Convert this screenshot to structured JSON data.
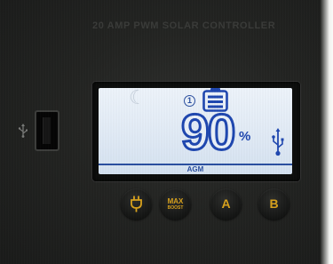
{
  "device": {
    "title": "20 AMP PWM  SOLAR CONTROLLER"
  },
  "display": {
    "mode_indicator": "1",
    "percentage_value": "90",
    "percent_unit": "%",
    "battery_type": "AGM",
    "battery_level_fraction": 1.0,
    "icons": [
      "moon-icon",
      "battery-icon",
      "usb-icon"
    ]
  },
  "buttons": {
    "power_icon": "plug-icon",
    "max_label": "MAX",
    "max_sublabel": "BOOST",
    "a_label": "A",
    "b_label": "B"
  },
  "colors": {
    "lcd_background": "#e3edf7",
    "lcd_segments": "#1f47b0",
    "button_text": "#d9a21c",
    "panel": "#252624"
  }
}
